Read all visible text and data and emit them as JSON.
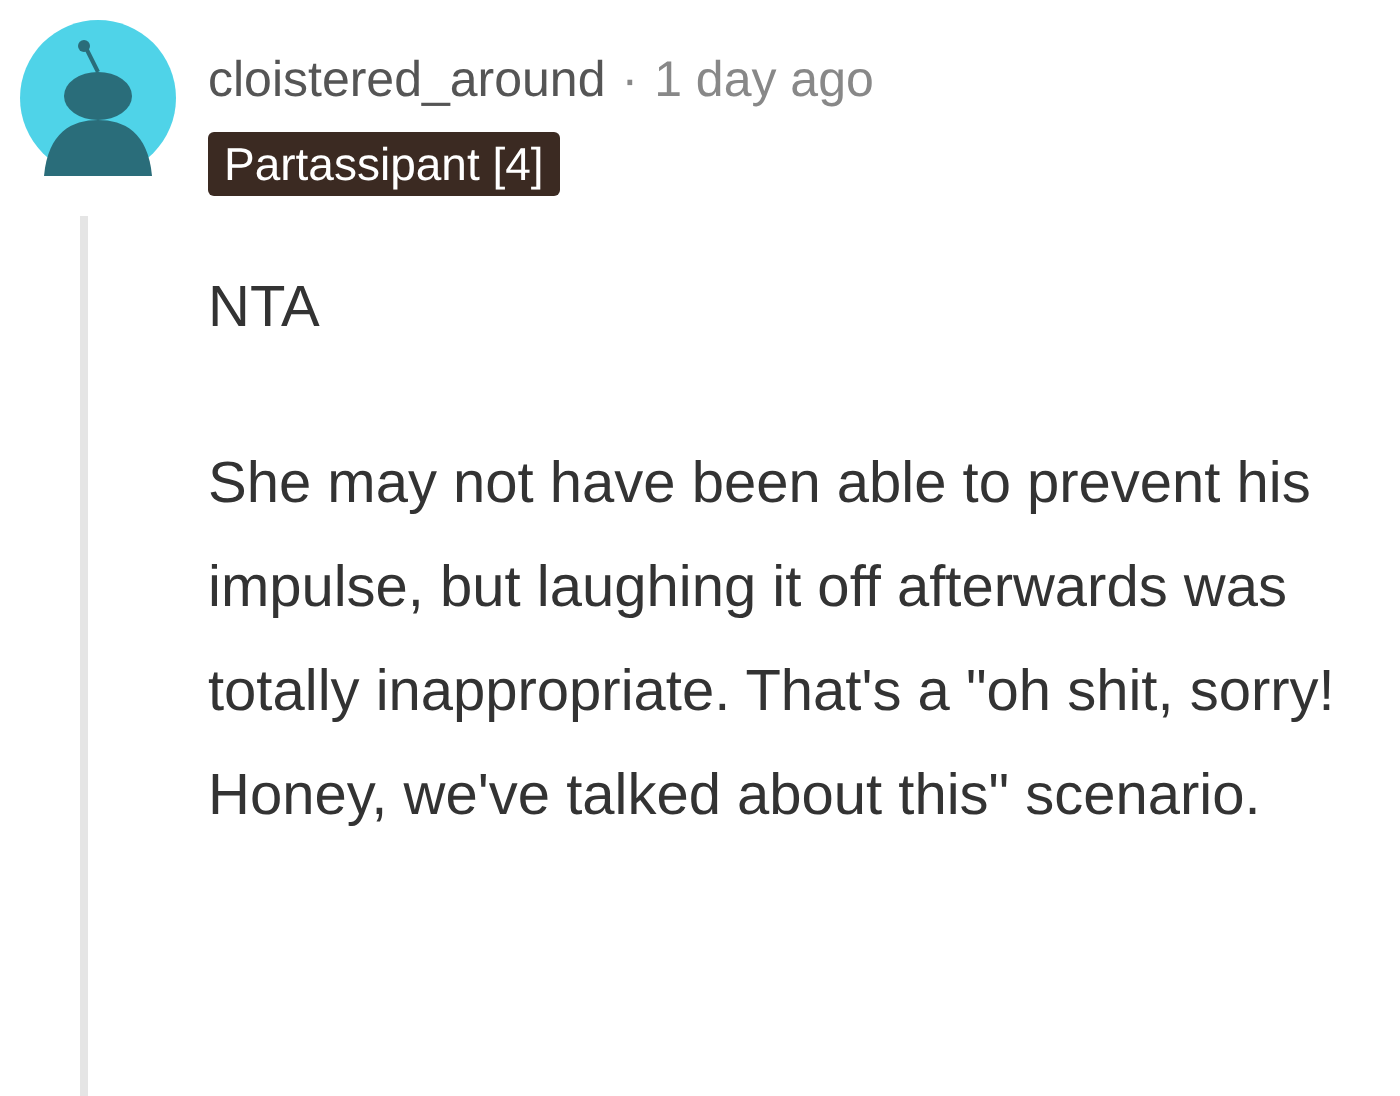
{
  "comment": {
    "author": "cloistered_around",
    "separator": "·",
    "time": "1 day ago",
    "flair": "Partassipant [4]",
    "paragraphs": [
      "NTA",
      "She may not have been able to prevent his impulse, but laughing it off afterwards was totally inappropriate. That's a \"oh shit, sorry! Honey, we've talked about this\" scenario."
    ]
  }
}
